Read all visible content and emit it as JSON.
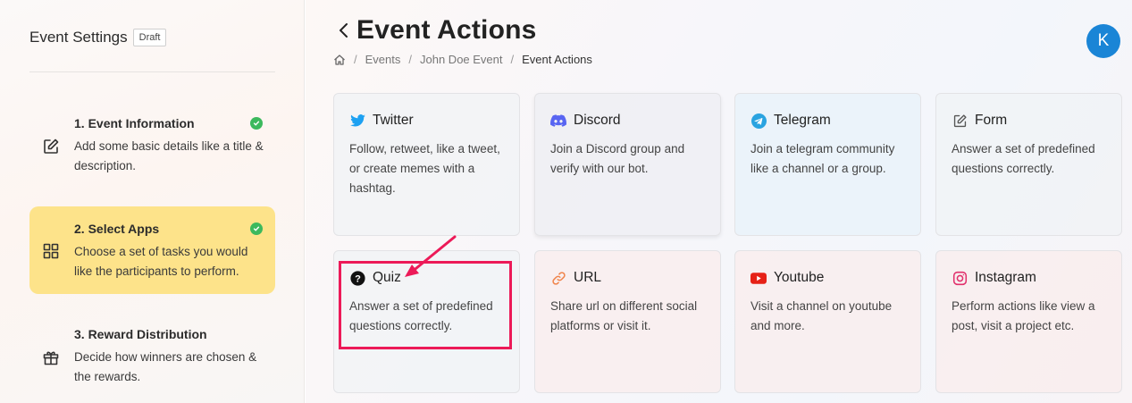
{
  "sidebar": {
    "title": "Event Settings",
    "badge": "Draft",
    "steps": [
      {
        "title": "1. Event Information",
        "desc": "Add some basic details like a title & description.",
        "icon": "edit-icon",
        "completed": true
      },
      {
        "title": "2. Select Apps",
        "desc": "Choose a set of tasks you would like the participants to perform.",
        "icon": "grid-icon",
        "completed": true,
        "active": true
      },
      {
        "title": "3. Reward Distribution",
        "desc": "Decide how winners are chosen & the rewards.",
        "icon": "gift-icon",
        "completed": false
      }
    ]
  },
  "header": {
    "title": "Event Actions",
    "avatar_initial": "K",
    "breadcrumb": [
      "Events",
      "John Doe Event",
      "Event Actions"
    ]
  },
  "cards": [
    {
      "title": "Twitter",
      "desc": "Follow, retweet, like a tweet, or create memes with a hashtag.",
      "icon": "twitter-icon",
      "color": "#1da1f2"
    },
    {
      "title": "Discord",
      "desc": "Join a Discord group and verify with our bot.",
      "icon": "discord-icon",
      "color": "#5865f2"
    },
    {
      "title": "Telegram",
      "desc": "Join a telegram community like a channel or a group.",
      "icon": "telegram-icon",
      "color": "#2aa3e0"
    },
    {
      "title": "Form",
      "desc": "Answer a set of predefined questions correctly.",
      "icon": "form-icon",
      "color": "#555555"
    },
    {
      "title": "Quiz",
      "desc": "Answer a set of predefined questions correctly.",
      "icon": "quiz-icon",
      "color": "#111111"
    },
    {
      "title": "URL",
      "desc": "Share url on different social platforms or visit it.",
      "icon": "link-icon",
      "color": "#f0844b"
    },
    {
      "title": "Youtube",
      "desc": "Visit a channel on youtube and more.",
      "icon": "youtube-icon",
      "color": "#e62117"
    },
    {
      "title": "Instagram",
      "desc": "Perform actions like view a post, visit a project etc.",
      "icon": "instagram-icon",
      "color": "#e1306c"
    }
  ],
  "annotation": {
    "color": "#ec1a58"
  }
}
